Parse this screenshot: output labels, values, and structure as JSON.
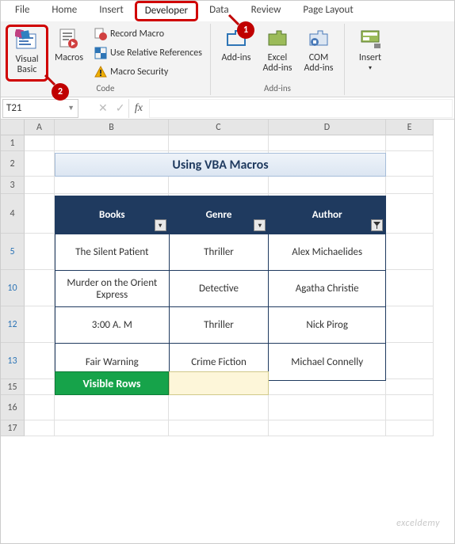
{
  "tabs": [
    {
      "label": "File"
    },
    {
      "label": "Home"
    },
    {
      "label": "Insert"
    },
    {
      "label": "Developer",
      "active": true
    },
    {
      "label": "Data"
    },
    {
      "label": "Review"
    },
    {
      "label": "Page Layout"
    }
  ],
  "ribbon": {
    "code_group_label": "Code",
    "addins_group_label": "Add-ins",
    "visual_basic": "Visual Basic",
    "macros": "Macros",
    "record_macro": "Record Macro",
    "use_relative": "Use Relative References",
    "macro_security": "Macro Security",
    "addins": "Add-ins",
    "excel_addins": "Excel Add-ins",
    "com_addins": "COM Add-ins",
    "insert": "Insert"
  },
  "callouts": {
    "one": "1",
    "two": "2"
  },
  "namebox": "T21",
  "fx_label": "fx",
  "columns": [
    "A",
    "B",
    "C",
    "D",
    "E"
  ],
  "rows": [
    "1",
    "2",
    "3",
    "4",
    "5",
    "10",
    "12",
    "13",
    "15",
    "16",
    "17"
  ],
  "filtered_rows": [
    "5",
    "10",
    "12",
    "13"
  ],
  "sheet_title": "Using VBA Macros",
  "headers": {
    "books": "Books",
    "genre": "Genre",
    "author": "Author"
  },
  "data": [
    {
      "books": "The Silent Patient",
      "genre": "Thriller",
      "author": "Alex Michaelides"
    },
    {
      "books": "Murder on the Orient Express",
      "genre": "Detective",
      "author": "Agatha Christie"
    },
    {
      "books": "3:00 A. M",
      "genre": "Thriller",
      "author": "Nick Pirog"
    },
    {
      "books": "Fair Warning",
      "genre": "Crime Fiction",
      "author": "Michael Connelly"
    }
  ],
  "visible_rows_label": "Visible Rows",
  "watermark": "exceldemy"
}
